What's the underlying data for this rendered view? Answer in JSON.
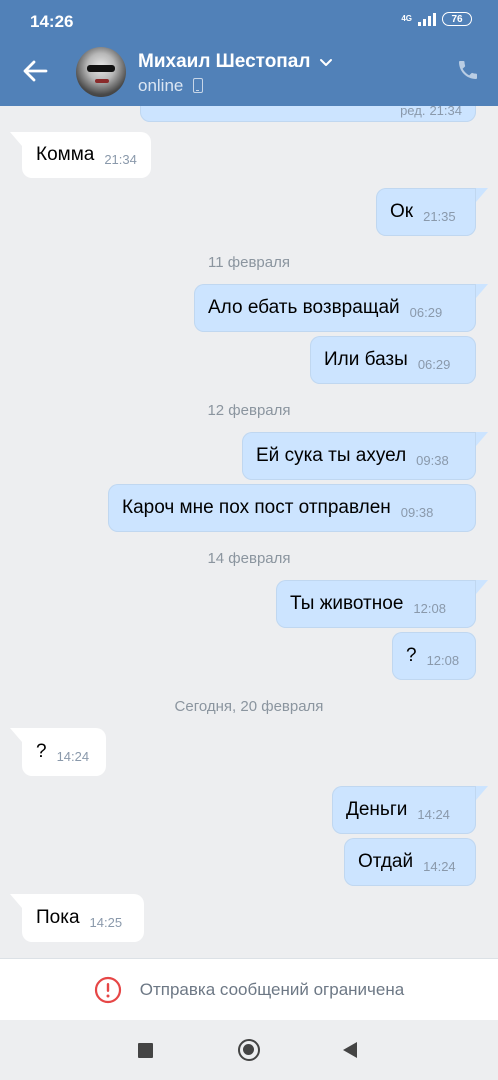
{
  "status_bar": {
    "time": "14:26",
    "network": "4G",
    "battery": "76"
  },
  "header": {
    "contact_name": "Михаил Шестопал",
    "status": "online",
    "icons": [
      "back-arrow-icon",
      "chevron-down-icon",
      "mobile-icon",
      "phone-icon"
    ]
  },
  "messages": [
    {
      "type": "out",
      "text": "",
      "edited": "ред.",
      "time": "21:34",
      "partial": true
    },
    {
      "type": "in",
      "text": "Комма",
      "time": "21:34"
    },
    {
      "type": "out",
      "text": "Ок",
      "time": "21:35"
    },
    {
      "type": "date",
      "text": "11 февраля"
    },
    {
      "type": "out",
      "text": "Ало ебать возвращай",
      "time": "06:29"
    },
    {
      "type": "out",
      "text": "Или базы",
      "time": "06:29"
    },
    {
      "type": "date",
      "text": "12 февраля"
    },
    {
      "type": "out",
      "text": "Ей сука ты ахуел",
      "time": "09:38"
    },
    {
      "type": "out",
      "text": "Кароч мне пох пост отправлен",
      "time": "09:38"
    },
    {
      "type": "date",
      "text": "14 февраля"
    },
    {
      "type": "out",
      "text": "Ты животное",
      "time": "12:08"
    },
    {
      "type": "out",
      "text": "?",
      "time": "12:08"
    },
    {
      "type": "date",
      "text": "Сегодня, 20 февраля"
    },
    {
      "type": "in",
      "text": "?",
      "time": "14:24"
    },
    {
      "type": "out",
      "text": "Деньги",
      "time": "14:24"
    },
    {
      "type": "out",
      "text": "Отдай",
      "time": "14:24"
    },
    {
      "type": "in",
      "text": "Пока",
      "time": "14:25"
    }
  ],
  "restricted_bar": {
    "text": "Отправка сообщений ограничена",
    "icon": "warning-circle-icon"
  },
  "nav_bar": {
    "icons": [
      "recents-square-icon",
      "home-circle-icon",
      "back-triangle-icon"
    ]
  },
  "colors": {
    "header": "#5181b8",
    "background": "#edeef0",
    "outgoing_bubble": "#cce4ff",
    "incoming_bubble": "#ffffff",
    "warning": "#e64646"
  }
}
